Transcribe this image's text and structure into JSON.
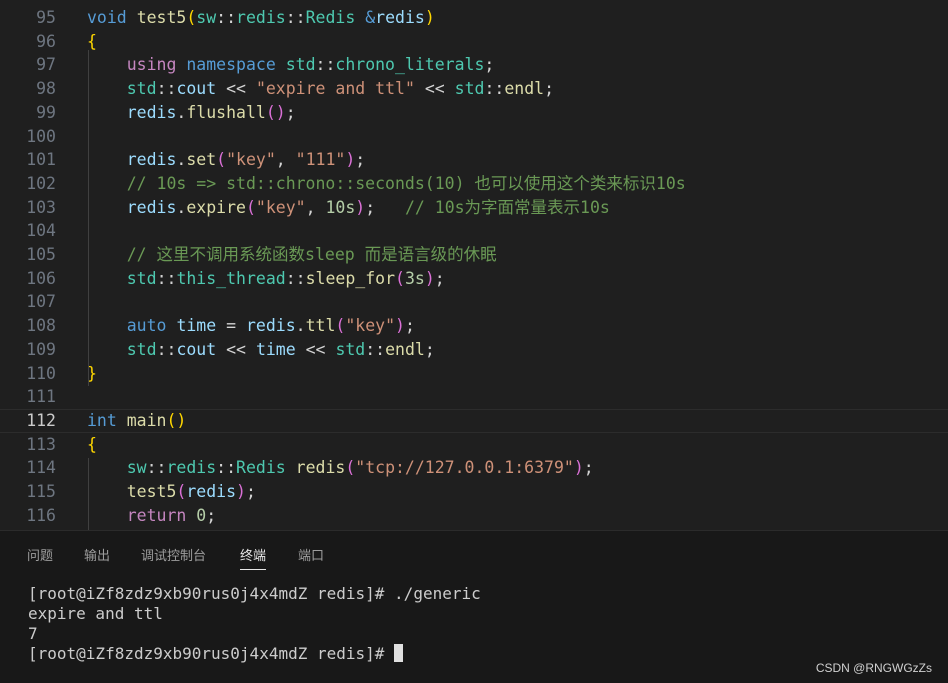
{
  "editor": {
    "lines": [
      {
        "num": "95",
        "tokens": [
          [
            "kw",
            "void"
          ],
          [
            "op",
            " "
          ],
          [
            "fn",
            "test5"
          ],
          [
            "br",
            "("
          ],
          [
            "ty",
            "sw"
          ],
          [
            "op",
            "::"
          ],
          [
            "ty",
            "redis"
          ],
          [
            "op",
            "::"
          ],
          [
            "ty",
            "Redis"
          ],
          [
            "op",
            " "
          ],
          [
            "kw",
            "&"
          ],
          [
            "vr",
            "redis"
          ],
          [
            "br",
            ")"
          ]
        ]
      },
      {
        "num": "96",
        "tokens": [
          [
            "br",
            "{"
          ]
        ]
      },
      {
        "num": "97",
        "tokens": [
          [
            "op",
            "    "
          ],
          [
            "kwc",
            "using"
          ],
          [
            "op",
            " "
          ],
          [
            "kw",
            "namespace"
          ],
          [
            "op",
            " "
          ],
          [
            "ty",
            "std"
          ],
          [
            "op",
            "::"
          ],
          [
            "ty",
            "chrono_literals"
          ],
          [
            "op",
            ";"
          ]
        ]
      },
      {
        "num": "98",
        "tokens": [
          [
            "op",
            "    "
          ],
          [
            "ty",
            "std"
          ],
          [
            "op",
            "::"
          ],
          [
            "vr",
            "cout"
          ],
          [
            "op",
            " << "
          ],
          [
            "st",
            "\"expire and ttl\""
          ],
          [
            "op",
            " << "
          ],
          [
            "ty",
            "std"
          ],
          [
            "op",
            "::"
          ],
          [
            "fn",
            "endl"
          ],
          [
            "op",
            ";"
          ]
        ]
      },
      {
        "num": "99",
        "tokens": [
          [
            "op",
            "    "
          ],
          [
            "vr",
            "redis"
          ],
          [
            "op",
            "."
          ],
          [
            "fn",
            "flushall"
          ],
          [
            "br2",
            "()"
          ],
          [
            "op",
            ";"
          ]
        ]
      },
      {
        "num": "100",
        "tokens": []
      },
      {
        "num": "101",
        "tokens": [
          [
            "op",
            "    "
          ],
          [
            "vr",
            "redis"
          ],
          [
            "op",
            "."
          ],
          [
            "fn",
            "set"
          ],
          [
            "br2",
            "("
          ],
          [
            "st",
            "\"key\""
          ],
          [
            "op",
            ", "
          ],
          [
            "st",
            "\"111\""
          ],
          [
            "br2",
            ")"
          ],
          [
            "op",
            ";"
          ]
        ]
      },
      {
        "num": "102",
        "tokens": [
          [
            "op",
            "    "
          ],
          [
            "cm",
            "// 10s => std::chrono::seconds(10) 也可以使用这个类来标识10s"
          ]
        ]
      },
      {
        "num": "103",
        "tokens": [
          [
            "op",
            "    "
          ],
          [
            "vr",
            "redis"
          ],
          [
            "op",
            "."
          ],
          [
            "fn",
            "expire"
          ],
          [
            "br2",
            "("
          ],
          [
            "st",
            "\"key\""
          ],
          [
            "op",
            ", "
          ],
          [
            "nu",
            "10s"
          ],
          [
            "br2",
            ")"
          ],
          [
            "op",
            ";   "
          ],
          [
            "cm",
            "// 10s为字面常量表示10s"
          ]
        ]
      },
      {
        "num": "104",
        "tokens": []
      },
      {
        "num": "105",
        "tokens": [
          [
            "op",
            "    "
          ],
          [
            "cm",
            "// 这里不调用系统函数sleep 而是语言级的休眠"
          ]
        ]
      },
      {
        "num": "106",
        "tokens": [
          [
            "op",
            "    "
          ],
          [
            "ty",
            "std"
          ],
          [
            "op",
            "::"
          ],
          [
            "ty",
            "this_thread"
          ],
          [
            "op",
            "::"
          ],
          [
            "fn",
            "sleep_for"
          ],
          [
            "br2",
            "("
          ],
          [
            "nu",
            "3s"
          ],
          [
            "br2",
            ")"
          ],
          [
            "op",
            ";"
          ]
        ]
      },
      {
        "num": "107",
        "tokens": []
      },
      {
        "num": "108",
        "tokens": [
          [
            "op",
            "    "
          ],
          [
            "kw",
            "auto"
          ],
          [
            "op",
            " "
          ],
          [
            "vr",
            "time"
          ],
          [
            "op",
            " = "
          ],
          [
            "vr",
            "redis"
          ],
          [
            "op",
            "."
          ],
          [
            "fn",
            "ttl"
          ],
          [
            "br2",
            "("
          ],
          [
            "st",
            "\"key\""
          ],
          [
            "br2",
            ")"
          ],
          [
            "op",
            ";"
          ]
        ]
      },
      {
        "num": "109",
        "tokens": [
          [
            "op",
            "    "
          ],
          [
            "ty",
            "std"
          ],
          [
            "op",
            "::"
          ],
          [
            "vr",
            "cout"
          ],
          [
            "op",
            " << "
          ],
          [
            "vr",
            "time"
          ],
          [
            "op",
            " << "
          ],
          [
            "ty",
            "std"
          ],
          [
            "op",
            "::"
          ],
          [
            "fn",
            "endl"
          ],
          [
            "op",
            ";"
          ]
        ]
      },
      {
        "num": "110",
        "tokens": [
          [
            "br",
            "}"
          ]
        ]
      },
      {
        "num": "111",
        "tokens": []
      },
      {
        "num": "112",
        "tokens": [
          [
            "kw",
            "int"
          ],
          [
            "op",
            " "
          ],
          [
            "fn",
            "main"
          ],
          [
            "br",
            "()"
          ]
        ],
        "current": true
      },
      {
        "num": "113",
        "tokens": [
          [
            "br",
            "{"
          ]
        ]
      },
      {
        "num": "114",
        "tokens": [
          [
            "op",
            "    "
          ],
          [
            "ty",
            "sw"
          ],
          [
            "op",
            "::"
          ],
          [
            "ty",
            "redis"
          ],
          [
            "op",
            "::"
          ],
          [
            "ty",
            "Redis"
          ],
          [
            "op",
            " "
          ],
          [
            "fn",
            "redis"
          ],
          [
            "br2",
            "("
          ],
          [
            "st",
            "\"tcp://127.0.0.1:6379\""
          ],
          [
            "br2",
            ")"
          ],
          [
            "op",
            ";"
          ]
        ]
      },
      {
        "num": "115",
        "tokens": [
          [
            "op",
            "    "
          ],
          [
            "fn",
            "test5"
          ],
          [
            "br2",
            "("
          ],
          [
            "vr",
            "redis"
          ],
          [
            "br2",
            ")"
          ],
          [
            "op",
            ";"
          ]
        ]
      },
      {
        "num": "116",
        "tokens": [
          [
            "op",
            "    "
          ],
          [
            "kwc",
            "return"
          ],
          [
            "op",
            " "
          ],
          [
            "nu",
            "0"
          ],
          [
            "op",
            ";"
          ]
        ]
      }
    ]
  },
  "panel": {
    "tabs": [
      {
        "label": "问题",
        "active": false
      },
      {
        "label": "输出",
        "active": false
      },
      {
        "label": "调试控制台",
        "active": false
      },
      {
        "label": "终端",
        "active": true
      },
      {
        "label": "端口",
        "active": false
      }
    ],
    "terminal": {
      "line1": "[root@iZf8zdz9xb90rus0j4x4mdZ redis]# ./generic",
      "line2": "expire and ttl",
      "line3": "7",
      "prompt": "[root@iZf8zdz9xb90rus0j4x4mdZ redis]# "
    }
  },
  "watermark": "CSDN @RNGWGzZs"
}
